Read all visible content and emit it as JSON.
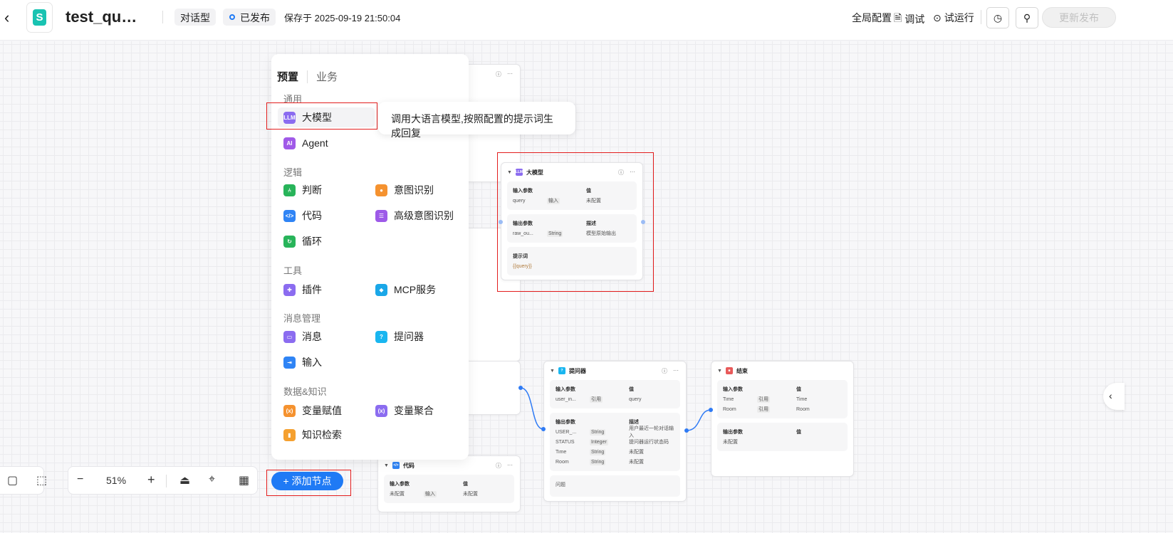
{
  "header": {
    "back_icon": "chevron-left-icon",
    "title": "test_qu…",
    "type_chip": "对话型",
    "status": "已发布",
    "saved": "保存于 2025-09-19 21:50:04",
    "global_config": "全局配置",
    "debug": "调试",
    "trial_run": "试运行",
    "history_icon": "history-icon",
    "graph_icon": "graph-icon",
    "publish": "更新发布"
  },
  "menu": {
    "tabs": [
      "预置",
      "业务"
    ],
    "groups": [
      {
        "title": "通用",
        "items": [
          {
            "label": "大模型",
            "icon": "LLM",
            "color": "#8b6cf0"
          },
          {
            "label": "Agent",
            "icon": "AI",
            "color": "#a05ae8"
          }
        ]
      },
      {
        "title": "逻辑",
        "items": [
          {
            "label": "判断",
            "icon": "⑃",
            "color": "#28b45a"
          },
          {
            "label": "意图识别",
            "icon": "👤",
            "color": "#f5922f"
          },
          {
            "label": "代码",
            "icon": "</>",
            "color": "#2f84f5"
          },
          {
            "label": "高级意图识别",
            "icon": "☰",
            "color": "#9d5ae8"
          },
          {
            "label": "循环",
            "icon": "↻",
            "color": "#28b45a"
          }
        ]
      },
      {
        "title": "工具",
        "items": [
          {
            "label": "插件",
            "icon": "✚",
            "color": "#8b6cf0"
          },
          {
            "label": "MCP服务",
            "icon": "◆",
            "color": "#1aa7e8"
          }
        ]
      },
      {
        "title": "消息管理",
        "items": [
          {
            "label": "消息",
            "icon": "▭",
            "color": "#8b6cf0"
          },
          {
            "label": "提问器",
            "icon": "?",
            "color": "#19b6f0"
          },
          {
            "label": "输入",
            "icon": "⇥",
            "color": "#2f84f5"
          }
        ]
      },
      {
        "title": "数据&知识",
        "items": [
          {
            "label": "变量赋值",
            "icon": "(x)",
            "color": "#f5922f"
          },
          {
            "label": "变量聚合",
            "icon": "(x)",
            "color": "#8b6cf0"
          },
          {
            "label": "知识检索",
            "icon": "▮",
            "color": "#f5a02f"
          }
        ]
      }
    ],
    "tooltip": "调用大语言模型,按照配置的提示词生成回复"
  },
  "nodes": {
    "llm": {
      "title": "大模型",
      "in_h": [
        "输入参数",
        "值"
      ],
      "in": [
        [
          "query",
          "输入",
          "未配置"
        ]
      ],
      "out_h": [
        "输出参数",
        "描述"
      ],
      "out": [
        [
          "raw_ou...",
          "String",
          "模型原始输出"
        ]
      ],
      "prompt_label": "提示词",
      "prompt": "{{query}}"
    },
    "asker": {
      "title": "提问器",
      "in_h": [
        "输入参数",
        "值"
      ],
      "in": [
        [
          "user_in...",
          "引用",
          "query"
        ]
      ],
      "out_h": [
        "输出参数",
        "描述"
      ],
      "out": [
        [
          "USER_...",
          "String",
          "用户最近一轮对话输入"
        ],
        [
          "STATUS",
          "Integer",
          "提问器运行状态码"
        ],
        [
          "Time",
          "String",
          "未配置"
        ],
        [
          "Room",
          "String",
          "未配置"
        ]
      ],
      "q_label": "问题"
    },
    "end": {
      "title": "结束",
      "in_h": [
        "输入参数",
        "值"
      ],
      "in": [
        [
          "Time",
          "引用",
          "Time"
        ],
        [
          "Room",
          "引用",
          "Room"
        ]
      ],
      "out_h": [
        "输出参数",
        "值"
      ],
      "out_empty": "未配置"
    },
    "code": {
      "title": "代码",
      "in_h": [
        "输入参数",
        "值"
      ],
      "in": [
        [
          "未配置",
          "输入",
          "未配置"
        ]
      ]
    }
  },
  "toolbar": {
    "zoom": "51%",
    "add_node": "+ 添加节点"
  }
}
